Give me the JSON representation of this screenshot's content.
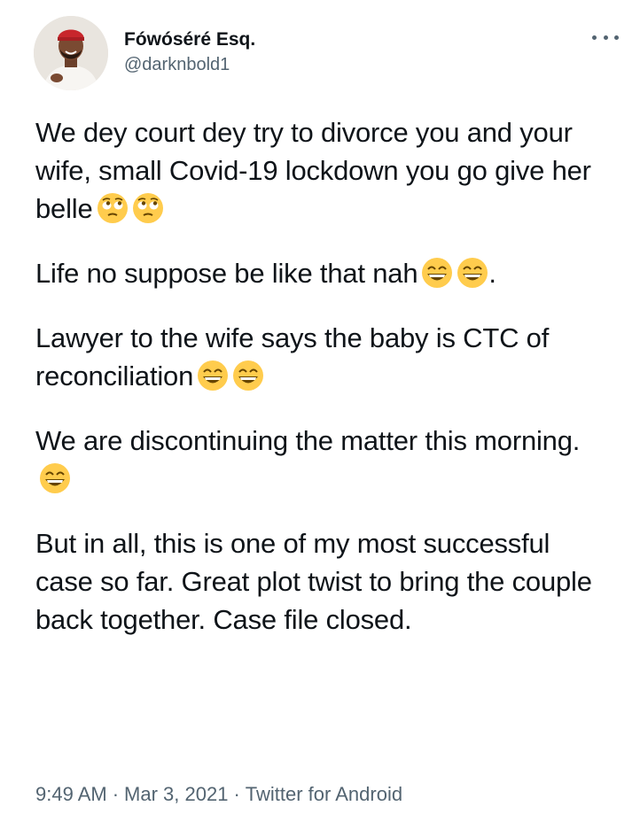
{
  "author": {
    "display_name": "Fówóséré Esq.",
    "handle": "@darknbold1"
  },
  "tweet": {
    "paragraphs": [
      {
        "text": "We dey court dey try to divorce you and your wife, small Covid-19 lockdown you go give her belle",
        "emoji": "face-with-rolling-eyes",
        "emoji_count": 2,
        "suffix": ""
      },
      {
        "text": "Life no suppose be like that nah",
        "emoji": "grinning-face-with-smiling-eyes",
        "emoji_count": 2,
        "suffix": "."
      },
      {
        "text": "Lawyer to the wife says the baby is CTC of reconciliation",
        "emoji": "grinning-face-with-smiling-eyes",
        "emoji_count": 2,
        "suffix": ""
      },
      {
        "text": "We are discontinuing the matter this morning.",
        "emoji": "grinning-face-with-smiling-eyes",
        "emoji_count": 1,
        "suffix": ""
      },
      {
        "text": "But in all, this is one of my most successful case so far. Great plot twist to bring the couple back together. Case file closed.",
        "emoji": "",
        "emoji_count": 0,
        "suffix": ""
      }
    ]
  },
  "meta": {
    "time": "9:49 AM",
    "separator": "·",
    "date": "Mar 3, 2021",
    "source": "Twitter for Android"
  },
  "icons": {
    "more": "more-options-icon",
    "avatar": "avatar"
  },
  "colors": {
    "text": "#0f1419",
    "secondary": "#536471",
    "emoji_yellow": "#ffcc4d"
  }
}
